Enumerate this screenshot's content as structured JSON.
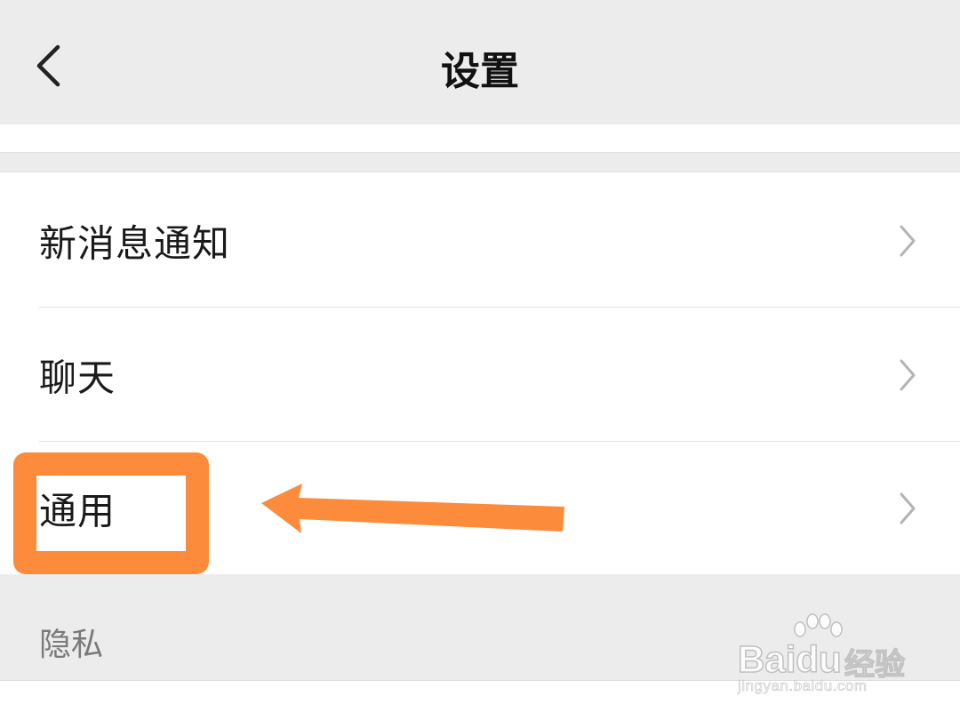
{
  "header": {
    "title": "设置",
    "back_icon": "chevron-left-icon"
  },
  "settings_items": [
    {
      "label": "新消息通知",
      "icon": "chevron-right-icon"
    },
    {
      "label": "聊天",
      "icon": "chevron-right-icon"
    },
    {
      "label": "通用",
      "icon": "chevron-right-icon"
    }
  ],
  "privacy_section": {
    "label": "隐私"
  },
  "annotation": {
    "highlight_color": "#fc8b3c",
    "arrow_color": "#fc8b3c"
  },
  "watermark": {
    "brand": "Baidu",
    "brand_cn": "经验",
    "url": "jingyan.baidu.com"
  },
  "colors": {
    "header_bg": "#ececec",
    "row_bg": "#ffffff",
    "chevron": "#b3b3b3",
    "section_label": "#7a7a7a"
  }
}
